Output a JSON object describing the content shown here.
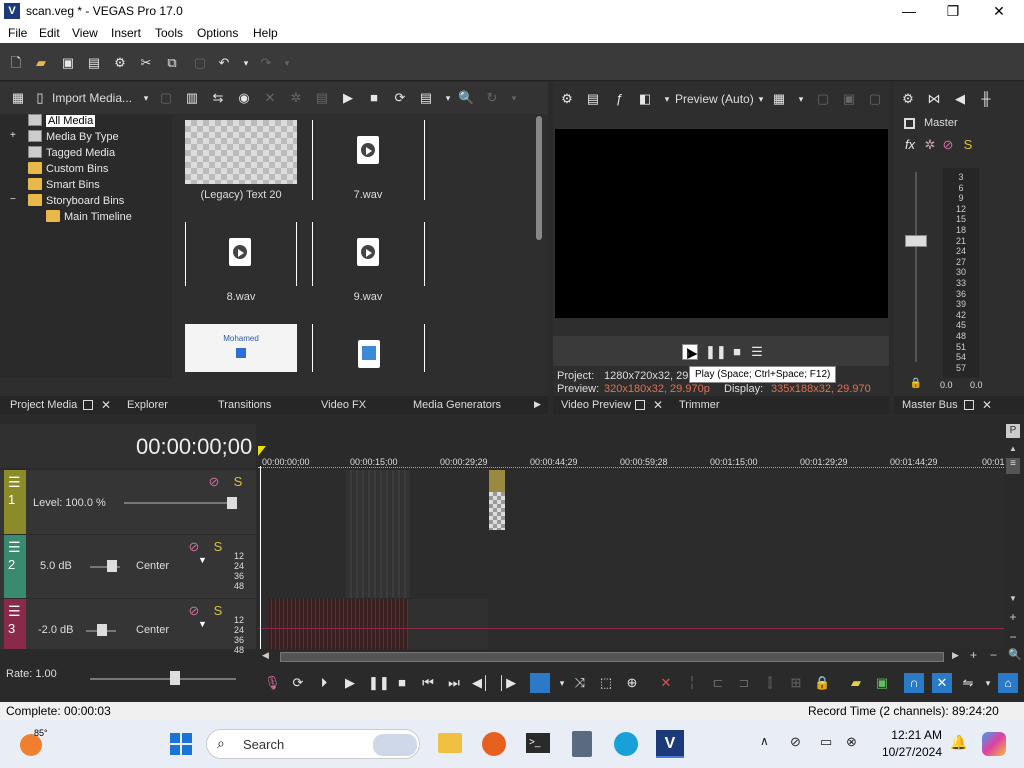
{
  "window": {
    "title": "scan.veg * - VEGAS Pro 17.0",
    "app_icon_letter": "V",
    "controls": {
      "minimize": "—",
      "maximize": "❐",
      "close": "✕"
    }
  },
  "menu": [
    "File",
    "Edit",
    "View",
    "Insert",
    "Tools",
    "Options",
    "Help"
  ],
  "project_media": {
    "import_label": "Import Media...",
    "tree": [
      {
        "label": "All Media",
        "selected": true
      },
      {
        "label": "Media By Type",
        "expander": "+"
      },
      {
        "label": "Tagged Media"
      },
      {
        "label": "Custom Bins"
      },
      {
        "label": "Smart Bins"
      },
      {
        "label": "Storyboard Bins",
        "expander": "−"
      },
      {
        "label": "Main Timeline"
      }
    ],
    "items": [
      {
        "label": "(Legacy) Text 20",
        "kind": "checker"
      },
      {
        "label": "7.wav",
        "kind": "wav"
      },
      {
        "label": "8.wav",
        "kind": "wav"
      },
      {
        "label": "9.wav",
        "kind": "wav"
      },
      {
        "label": "",
        "kind": "image",
        "thumb_text": "Mohamed"
      },
      {
        "label": "",
        "kind": "file"
      }
    ]
  },
  "preview": {
    "mode_label": "Preview (Auto)",
    "project_label": "Project:",
    "project_value": "1280x720x32, 29.970p",
    "preview_label": "Preview:",
    "preview_value": "320x180x32, 29.970p",
    "display_label": "Display:",
    "display_value": "335x188x32, 29.970",
    "tooltip": "Play (Space; Ctrl+Space; F12)"
  },
  "master": {
    "label": "Master",
    "scale": [
      "3",
      "6",
      "9",
      "12",
      "15",
      "18",
      "21",
      "24",
      "27",
      "30",
      "33",
      "36",
      "39",
      "42",
      "45",
      "48",
      "51",
      "54",
      "57"
    ],
    "left_value": "0.0",
    "right_value": "0.0"
  },
  "bottom_tabs": {
    "left": [
      "Project Media",
      "Explorer",
      "Transitions",
      "Video FX",
      "Media Generators"
    ],
    "middle": [
      "Video Preview",
      "Trimmer"
    ],
    "right": [
      "Master Bus"
    ]
  },
  "timeline": {
    "timecode": "00:00:00;00",
    "ruler": [
      "00:00:00;00",
      "00:00:15;00",
      "00:00:29;29",
      "00:00:44;29",
      "00:00:59;28",
      "00:01:15;00",
      "00:01:29;29",
      "00:01:44;29",
      "00:01"
    ],
    "tracks": [
      {
        "number": "1",
        "level_label": "Level: 100.0 %"
      },
      {
        "number": "2",
        "volume": "5.0 dB",
        "pan": "Center",
        "scale": [
          "12",
          "24",
          "36",
          "48"
        ]
      },
      {
        "number": "3",
        "volume": "-2.0 dB",
        "pan": "Center",
        "scale": [
          "12",
          "24",
          "36",
          "48"
        ]
      }
    ],
    "rate_label": "Rate: 1.00"
  },
  "status": {
    "left": "Complete: 00:00:03",
    "right": "Record Time (2 channels): 89:24:20"
  },
  "taskbar": {
    "weather": "85°",
    "search_placeholder": "Search",
    "time": "12:21 AM",
    "date": "10/27/2024"
  }
}
